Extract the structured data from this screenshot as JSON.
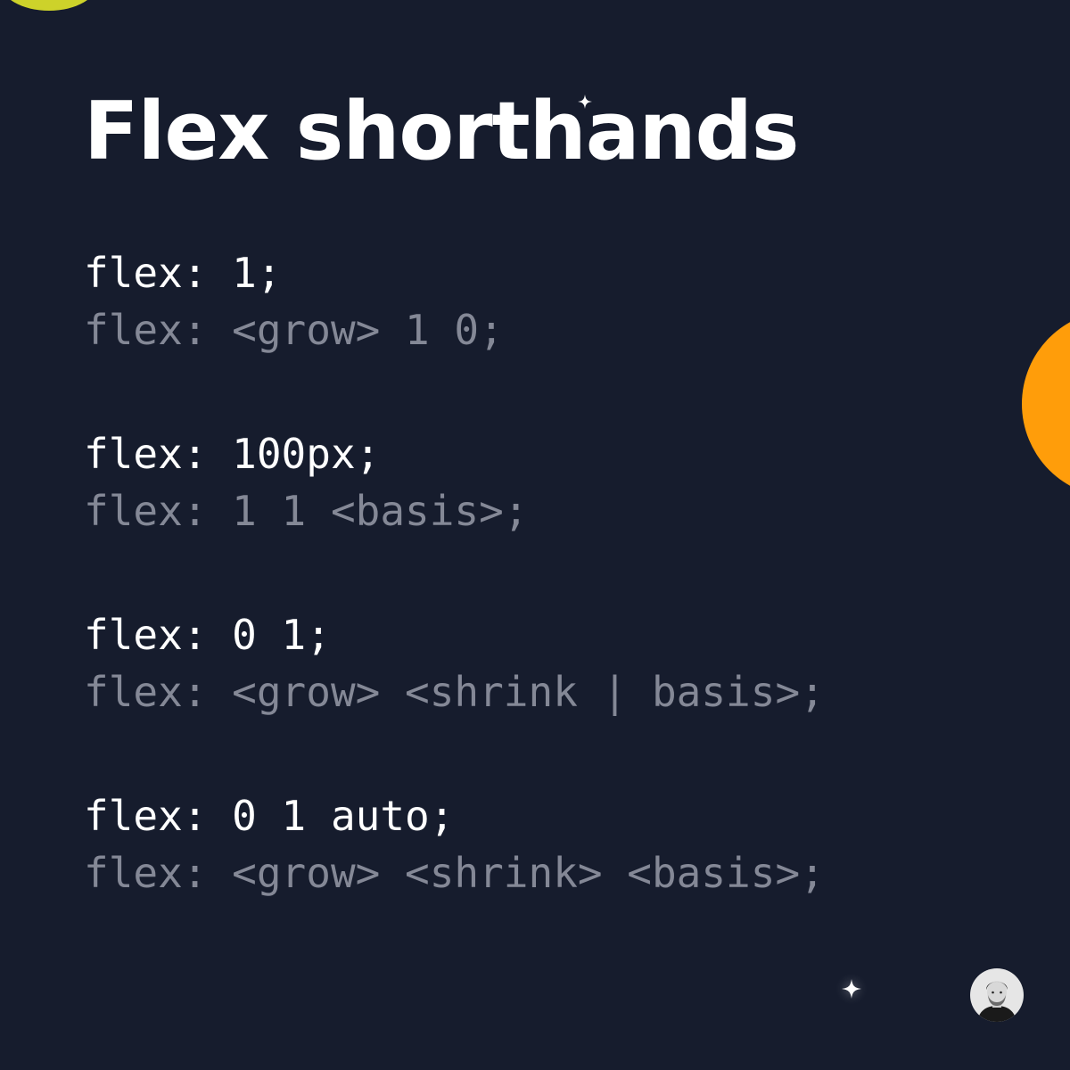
{
  "title": "Flex shorthands",
  "examples": [
    {
      "shorthand": "flex: 1;",
      "expanded": "flex: <grow> 1 0;"
    },
    {
      "shorthand": "flex: 100px;",
      "expanded": "flex: 1 1 <basis>;"
    },
    {
      "shorthand": "flex: 0 1;",
      "expanded": "flex: <grow> <shrink | basis>;"
    },
    {
      "shorthand": "flex: 0 1 auto;",
      "expanded": "flex: <grow> <shrink> <basis>;"
    }
  ],
  "colors": {
    "background": "#161c2d",
    "text_primary": "#ffffff",
    "text_muted": "#848896",
    "accent_yellow": "#cdd22a",
    "accent_orange": "#ff9d0a"
  },
  "icons": {
    "title_sparkle": "sparkle-icon",
    "footer_sparkle": "sparkle-icon",
    "author": "avatar"
  }
}
